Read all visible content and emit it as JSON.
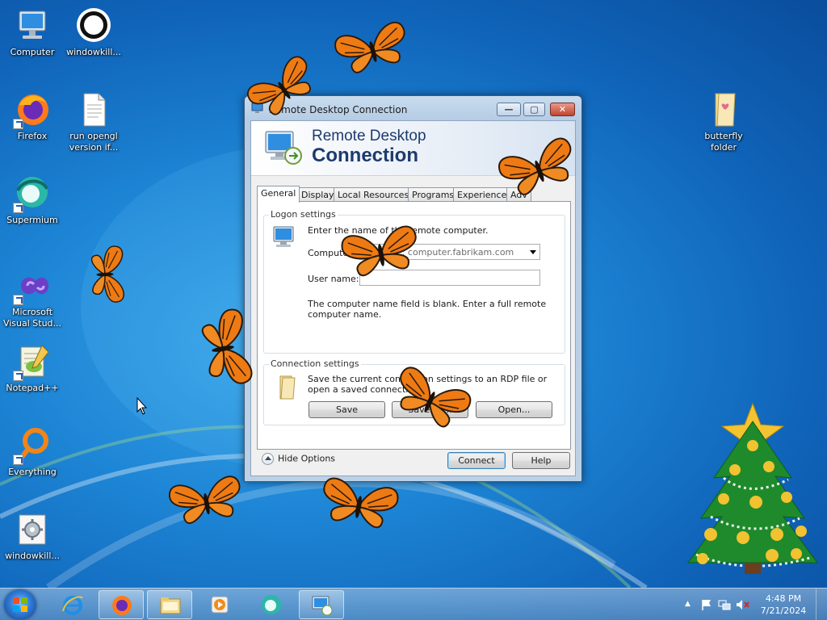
{
  "desktop": {
    "icons": [
      {
        "label": "Computer",
        "icon": "computer-icon"
      },
      {
        "label": "windowkill...",
        "icon": "ring-icon"
      },
      {
        "label": "Firefox",
        "icon": "firefox-icon"
      },
      {
        "label": "run opengl version if...",
        "icon": "text-file-icon"
      },
      {
        "label": "Supermium",
        "icon": "supermium-icon"
      },
      {
        "label": "Microsoft Visual Stud...",
        "icon": "visual-studio-icon"
      },
      {
        "label": "Notepad++",
        "icon": "notepadpp-icon"
      },
      {
        "label": "Everything",
        "icon": "everything-icon"
      },
      {
        "label": "windowkill...",
        "icon": "settings-file-icon"
      },
      {
        "label": "butterfly folder",
        "icon": "folder-icon"
      }
    ]
  },
  "window": {
    "title": "Remote Desktop Connection",
    "banner_line1": "Remote Desktop",
    "banner_line2": "Connection",
    "tabs": [
      {
        "label": "General"
      },
      {
        "label": "Display"
      },
      {
        "label": "Local Resources"
      },
      {
        "label": "Programs"
      },
      {
        "label": "Experience"
      },
      {
        "label": "Adv"
      }
    ],
    "logon": {
      "title": "Logon settings",
      "instruction": "Enter the name of the remote computer.",
      "computer_label": "Computer:",
      "computer_value": "Example: computer.fabrikam.com",
      "username_label": "User name:",
      "username_value": "",
      "warning": "The computer name field is blank. Enter a full remote computer name."
    },
    "connection": {
      "title": "Connection settings",
      "description": "Save the current connection settings to an RDP file or open a saved connection.",
      "save": "Save",
      "save_as": "Save As...",
      "open": "Open..."
    },
    "hide_options": "Hide Options",
    "connect": "Connect",
    "help": "Help"
  },
  "taskbar": {
    "items": [
      "windows-start-orb",
      "internet-explorer-icon",
      "firefox-icon",
      "file-explorer-icon",
      "media-player-icon",
      "supermium-icon",
      "remote-desktop-icon"
    ],
    "time": "4:48 PM",
    "date": "7/21/2024"
  },
  "colors": {
    "desktop_blue": "#1e86d6",
    "butterfly_orange": "#ee7a14",
    "title_text": "#1d3b6e"
  }
}
